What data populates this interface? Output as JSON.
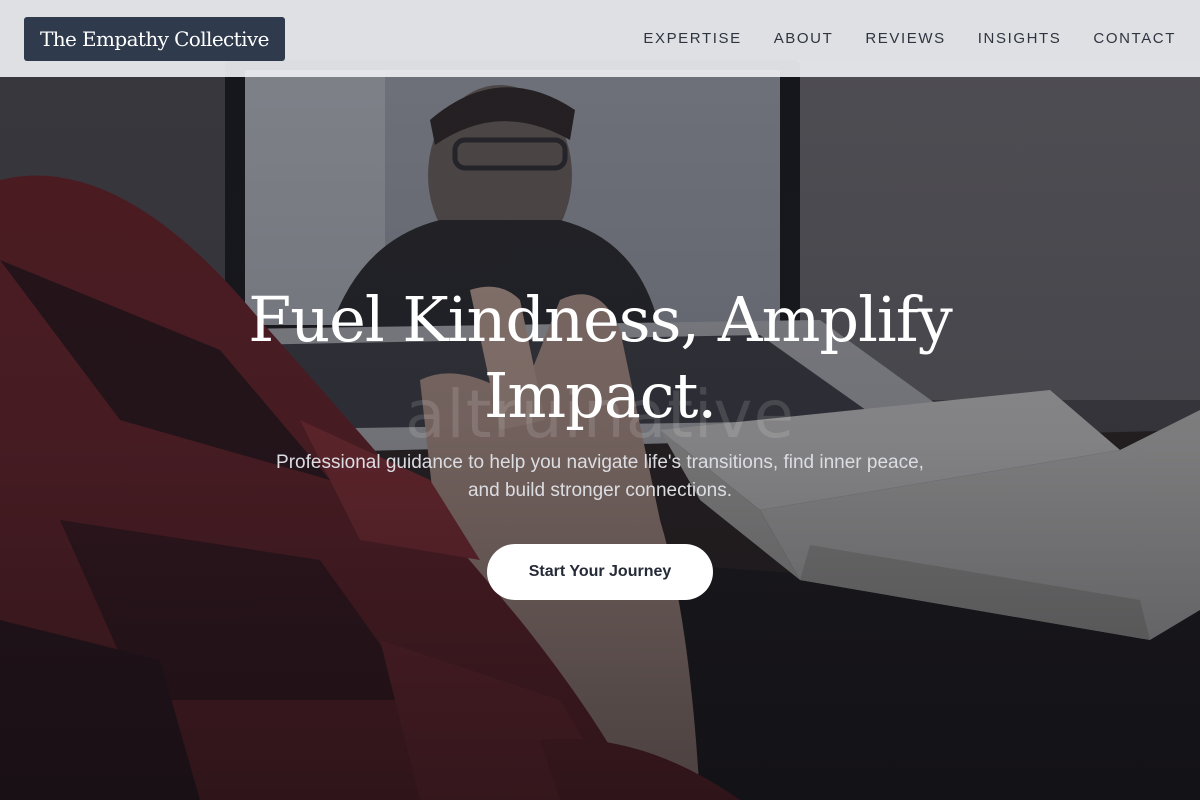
{
  "header": {
    "logo_text": "The Empathy Collective",
    "nav": [
      {
        "label": "EXPERTISE"
      },
      {
        "label": "ABOUT"
      },
      {
        "label": "REVIEWS"
      },
      {
        "label": "INSIGHTS"
      },
      {
        "label": "CONTACT"
      }
    ]
  },
  "hero": {
    "watermark_text": "altruinative",
    "headline_line1": "Fuel Kindness, Amplify",
    "headline_line2": "Impact.",
    "subtext": "Professional guidance to help you navigate life's transitions, find inner peace, and build stronger connections.",
    "cta_label": "Start Your Journey"
  },
  "colors": {
    "header_bg": "#ecedf0",
    "logo_bg": "#2f3a4c",
    "nav_text": "#2e3440",
    "cta_bg": "#ffffff",
    "cta_text": "#252a36",
    "headline_text": "#ffffff"
  }
}
